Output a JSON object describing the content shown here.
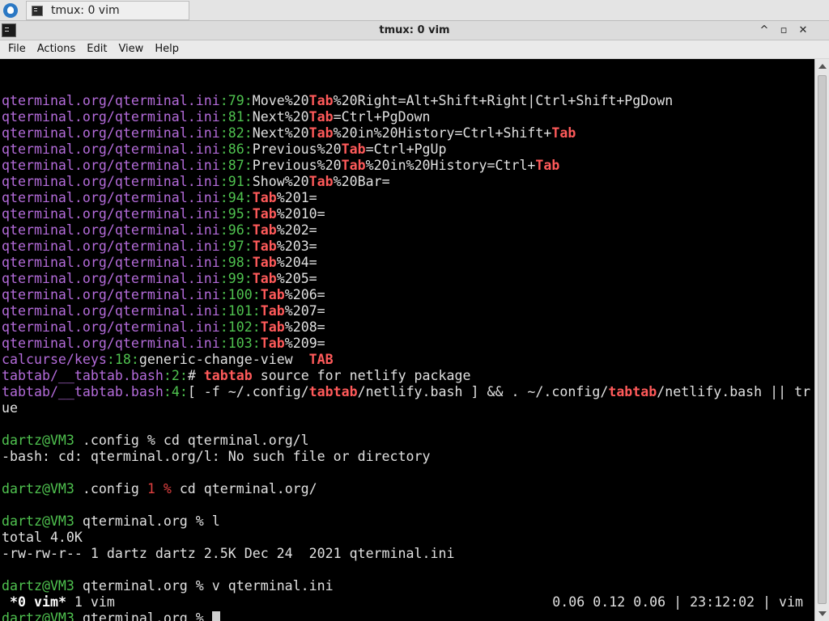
{
  "taskbar": {
    "task_title": "tmux: 0 vim"
  },
  "window": {
    "title": "tmux: 0 vim",
    "minimize": "^",
    "maximize": "▫",
    "close": "✕"
  },
  "menu": [
    "File",
    "Actions",
    "Edit",
    "View",
    "Help"
  ],
  "grep_lines": [
    {
      "path": "qterminal.org/qterminal.ini",
      "num": "79",
      "parts": [
        {
          "t": "Move%20"
        },
        {
          "t": "Tab",
          "h": true
        },
        {
          "t": "%20Right=Alt+Shift+Right|Ctrl+Shift+PgDown"
        }
      ]
    },
    {
      "path": "qterminal.org/qterminal.ini",
      "num": "81",
      "parts": [
        {
          "t": "Next%20"
        },
        {
          "t": "Tab",
          "h": true
        },
        {
          "t": "=Ctrl+PgDown"
        }
      ]
    },
    {
      "path": "qterminal.org/qterminal.ini",
      "num": "82",
      "parts": [
        {
          "t": "Next%20"
        },
        {
          "t": "Tab",
          "h": true
        },
        {
          "t": "%20in%20History=Ctrl+Shift+"
        },
        {
          "t": "Tab",
          "h": true
        }
      ]
    },
    {
      "path": "qterminal.org/qterminal.ini",
      "num": "86",
      "parts": [
        {
          "t": "Previous%20"
        },
        {
          "t": "Tab",
          "h": true
        },
        {
          "t": "=Ctrl+PgUp"
        }
      ]
    },
    {
      "path": "qterminal.org/qterminal.ini",
      "num": "87",
      "parts": [
        {
          "t": "Previous%20"
        },
        {
          "t": "Tab",
          "h": true
        },
        {
          "t": "%20in%20History=Ctrl+"
        },
        {
          "t": "Tab",
          "h": true
        }
      ]
    },
    {
      "path": "qterminal.org/qterminal.ini",
      "num": "91",
      "parts": [
        {
          "t": "Show%20"
        },
        {
          "t": "Tab",
          "h": true
        },
        {
          "t": "%20Bar="
        }
      ]
    },
    {
      "path": "qterminal.org/qterminal.ini",
      "num": "94",
      "parts": [
        {
          "t": "Tab",
          "h": true
        },
        {
          "t": "%201="
        }
      ]
    },
    {
      "path": "qterminal.org/qterminal.ini",
      "num": "95",
      "parts": [
        {
          "t": "Tab",
          "h": true
        },
        {
          "t": "%2010="
        }
      ]
    },
    {
      "path": "qterminal.org/qterminal.ini",
      "num": "96",
      "parts": [
        {
          "t": "Tab",
          "h": true
        },
        {
          "t": "%202="
        }
      ]
    },
    {
      "path": "qterminal.org/qterminal.ini",
      "num": "97",
      "parts": [
        {
          "t": "Tab",
          "h": true
        },
        {
          "t": "%203="
        }
      ]
    },
    {
      "path": "qterminal.org/qterminal.ini",
      "num": "98",
      "parts": [
        {
          "t": "Tab",
          "h": true
        },
        {
          "t": "%204="
        }
      ]
    },
    {
      "path": "qterminal.org/qterminal.ini",
      "num": "99",
      "parts": [
        {
          "t": "Tab",
          "h": true
        },
        {
          "t": "%205="
        }
      ]
    },
    {
      "path": "qterminal.org/qterminal.ini",
      "num": "100",
      "parts": [
        {
          "t": "Tab",
          "h": true
        },
        {
          "t": "%206="
        }
      ]
    },
    {
      "path": "qterminal.org/qterminal.ini",
      "num": "101",
      "parts": [
        {
          "t": "Tab",
          "h": true
        },
        {
          "t": "%207="
        }
      ]
    },
    {
      "path": "qterminal.org/qterminal.ini",
      "num": "102",
      "parts": [
        {
          "t": "Tab",
          "h": true
        },
        {
          "t": "%208="
        }
      ]
    },
    {
      "path": "qterminal.org/qterminal.ini",
      "num": "103",
      "parts": [
        {
          "t": "Tab",
          "h": true
        },
        {
          "t": "%209="
        }
      ]
    },
    {
      "path": "calcurse/keys",
      "num": "18",
      "parts": [
        {
          "t": "generic-change-view  "
        },
        {
          "t": "TAB",
          "h": true
        }
      ]
    },
    {
      "path": "tabtab/__tabtab.bash",
      "num": "2",
      "parts": [
        {
          "t": "# "
        },
        {
          "t": "tabtab",
          "h": true
        },
        {
          "t": " source for netlify package"
        }
      ]
    },
    {
      "path": "tabtab/__tabtab.bash",
      "num": "4",
      "parts": [
        {
          "t": "[ -f ~/.config/"
        },
        {
          "t": "tabtab",
          "h": true
        },
        {
          "t": "/netlify.bash ] && . ~/.config/"
        },
        {
          "t": "tabtab",
          "h": true
        },
        {
          "t": "/netlify.bash || tr"
        }
      ]
    }
  ],
  "wrap_line": "ue",
  "session": [
    {
      "kind": "blank"
    },
    {
      "kind": "prompt",
      "user": "dartz@VM3",
      "dir": " .config ",
      "status": "",
      "sym": "%",
      "cmd": " cd qterminal.org/l"
    },
    {
      "kind": "out",
      "text": "-bash: cd: qterminal.org/l: No such file or directory"
    },
    {
      "kind": "blank"
    },
    {
      "kind": "prompt",
      "user": "dartz@VM3",
      "dir": " .config ",
      "status": "1 %",
      "sym": "",
      "cmd": " cd qterminal.org/"
    },
    {
      "kind": "blank"
    },
    {
      "kind": "prompt",
      "user": "dartz@VM3",
      "dir": " qterminal.org ",
      "status": "",
      "sym": "%",
      "cmd": " l"
    },
    {
      "kind": "out",
      "text": "total 4.0K"
    },
    {
      "kind": "out",
      "text": "-rw-rw-r-- 1 dartz dartz 2.5K Dec 24  2021 qterminal.ini"
    },
    {
      "kind": "blank"
    },
    {
      "kind": "prompt",
      "user": "dartz@VM3",
      "dir": " qterminal.org ",
      "status": "",
      "sym": "%",
      "cmd": " v qterminal.ini"
    },
    {
      "kind": "blank"
    },
    {
      "kind": "prompt",
      "user": "dartz@VM3",
      "dir": " qterminal.org ",
      "status": "",
      "sym": "%",
      "cmd": " ",
      "cursor": true
    }
  ],
  "status": {
    "window_active": "*0 vim*",
    "window_other": " 1 vim",
    "right": "0.06 0.12 0.06 | 23:12:02 | vim"
  },
  "colors": {
    "path": "#b36bd9",
    "number": "#4fc24f",
    "match": "#ff5a5a",
    "prompt_user": "#4fc24f",
    "error_status": "#e04040"
  }
}
